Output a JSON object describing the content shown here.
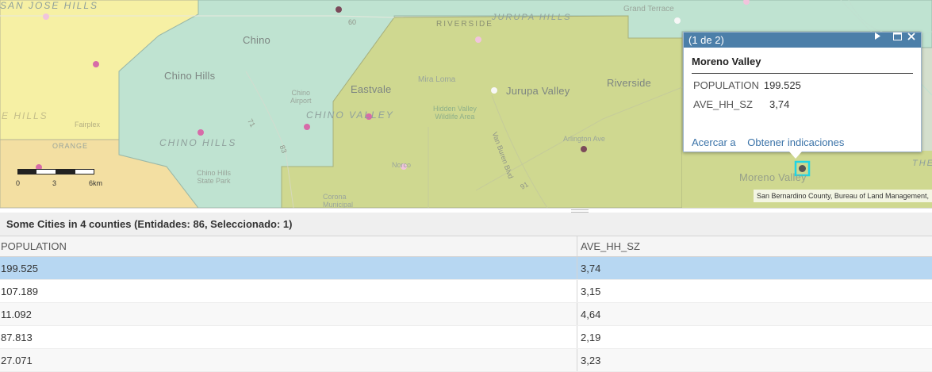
{
  "map": {
    "place_labels": {
      "san_jose_hills": "SAN JOSE HILLS",
      "chino": "Chino",
      "chino_hills": "Chino Hills",
      "chino_hills_area": "CHINO HILLS",
      "chino_valley": "CHINO VALLEY",
      "chino_airport": "Chino\nAirport",
      "eastvale": "Eastvale",
      "mira_loma": "Mira Loma",
      "jurupa_valley": "Jurupa Valley",
      "jurupa_hills": "JURUPA HILLS",
      "riverside": "Riverside",
      "riverside_area": "RIVERSIDE",
      "grand_terrace": "Grand Terrace",
      "arlington_ave": "Arlington Ave",
      "norco": "Norco",
      "moreno_valley": "Moreno Valley",
      "orange": "ORANGE",
      "hills": "E HILLS",
      "fairplex": "Fairplex",
      "chino_hills_state_park": "Chino Hills\nState Park",
      "hidden_valley": "Hidden Valley\nWildlife Area",
      "van_buren": "Van Buren Blvd",
      "corona_municipal": "Corona\nMunicipal",
      "route_60": "60",
      "route_71": "71",
      "route_83": "83",
      "route_91": "91",
      "the_edge": "THE"
    },
    "scale": {
      "tick_0": "0",
      "tick_1": "3",
      "tick_2": "6km"
    },
    "attribution": "San Bernardino County, Bureau of Land Management,",
    "colors": {
      "county_yellow": "#f6f0a4",
      "county_orange": "#f3dfa2",
      "county_teal": "#bfe3d1",
      "county_green": "#cfd890",
      "point_pink": "#d76ba8",
      "point_light": "#f1c4dc",
      "point_dark": "#7b4a5a",
      "selection": "#20d4e4"
    }
  },
  "popup": {
    "counter": "(1 de 2)",
    "title": "Moreno Valley",
    "fields": [
      {
        "label": "POPULATION",
        "value": "199.525"
      },
      {
        "label": "AVE_HH_SZ",
        "value": "3,74"
      }
    ],
    "actions": {
      "zoom": "Acercar a",
      "directions": "Obtener indicaciones"
    }
  },
  "table": {
    "title": "Some Cities in 4 counties (Entidades: 86, Seleccionado: 1)",
    "columns": [
      "POPULATION",
      "AVE_HH_SZ"
    ],
    "rows": [
      {
        "population": "199.525",
        "ave_hh_sz": "3,74",
        "selected": true
      },
      {
        "population": "107.189",
        "ave_hh_sz": "3,15",
        "selected": false
      },
      {
        "population": "11.092",
        "ave_hh_sz": "4,64",
        "selected": false
      },
      {
        "population": "87.813",
        "ave_hh_sz": "2,19",
        "selected": false
      },
      {
        "population": "27.071",
        "ave_hh_sz": "3,23",
        "selected": false
      }
    ]
  }
}
